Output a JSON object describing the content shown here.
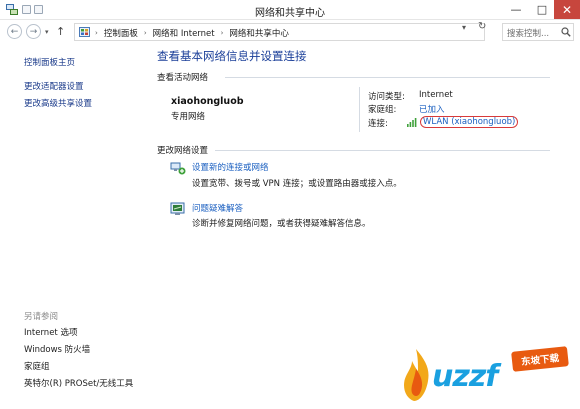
{
  "window": {
    "title": "网络和共享中心",
    "min_glyph": "—",
    "max_glyph": "□",
    "close_glyph": "✕"
  },
  "nav": {
    "back_glyph": "←",
    "forward_glyph": "→",
    "dropdown_glyph": "▾",
    "up_glyph": "↑",
    "breadcrumbs": [
      "控制面板",
      "网络和 Internet",
      "网络和共享中心"
    ],
    "crumb_separator": "›",
    "address_dropdown_glyph": "▾",
    "refresh_glyph": "↻",
    "search_placeholder": "搜索控制..."
  },
  "left_pane": {
    "links": [
      "控制面板主页",
      "更改适配器设置",
      "更改高级共享设置"
    ],
    "see_also_label": "另请参阅",
    "see_also": [
      "Internet 选项",
      "Windows 防火墙",
      "家庭组",
      "英特尔(R) PROSet/无线工具"
    ]
  },
  "main": {
    "title": "查看基本网络信息并设置连接",
    "active_networks_label": "查看活动网络",
    "network_name": "xiaohongluob",
    "network_type": "专用网络",
    "access_type_label": "访问类型:",
    "access_type_value": "Internet",
    "homegroup_label": "家庭组:",
    "homegroup_value": "已加入",
    "connection_label": "连接:",
    "connection_value": "WLAN (xiaohongluob)",
    "change_settings_label": "更改网络设置",
    "tasks": [
      {
        "link": "设置新的连接或网络",
        "desc": "设置宽带、拨号或 VPN 连接；或设置路由器或接入点。"
      },
      {
        "link": "问题疑难解答",
        "desc": "诊断并修复网络问题，或者获得疑难解答信息。"
      }
    ]
  },
  "watermark": {
    "text": "uzzf",
    "badge": "东坡下载"
  },
  "colors": {
    "link": "#1a5fc0",
    "title": "#1b3f99",
    "close": "#c7463d",
    "annotation": "#d83a3a"
  }
}
